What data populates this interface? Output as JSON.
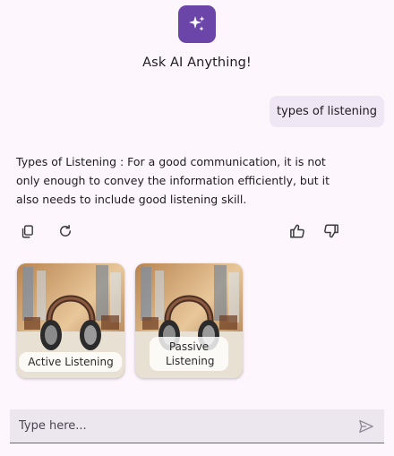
{
  "header": {
    "logo_icon": "sparkles-icon",
    "title": "Ask AI Anything!"
  },
  "colors": {
    "brand": "#6b46a8",
    "user_bubble": "#f0e7f5",
    "input_bg": "#ece6ee",
    "icon_gray": "#3b3b3b"
  },
  "chat": {
    "user_message": "types of listening",
    "ai_response": "Types of Listening : For a good communication, it is not only enough to convey the information efficiently, but it also needs to include good listening skill."
  },
  "actions": {
    "left": [
      "copy-icon",
      "refresh-icon"
    ],
    "right": [
      "thumbs-up-icon",
      "thumbs-down-icon"
    ]
  },
  "cards": [
    {
      "label": "Active Listening",
      "image": "headphones-image"
    },
    {
      "label": "Passive Listening",
      "image": "headphones-image"
    }
  ],
  "composer": {
    "placeholder": "Type here...",
    "send_icon": "send-icon"
  }
}
